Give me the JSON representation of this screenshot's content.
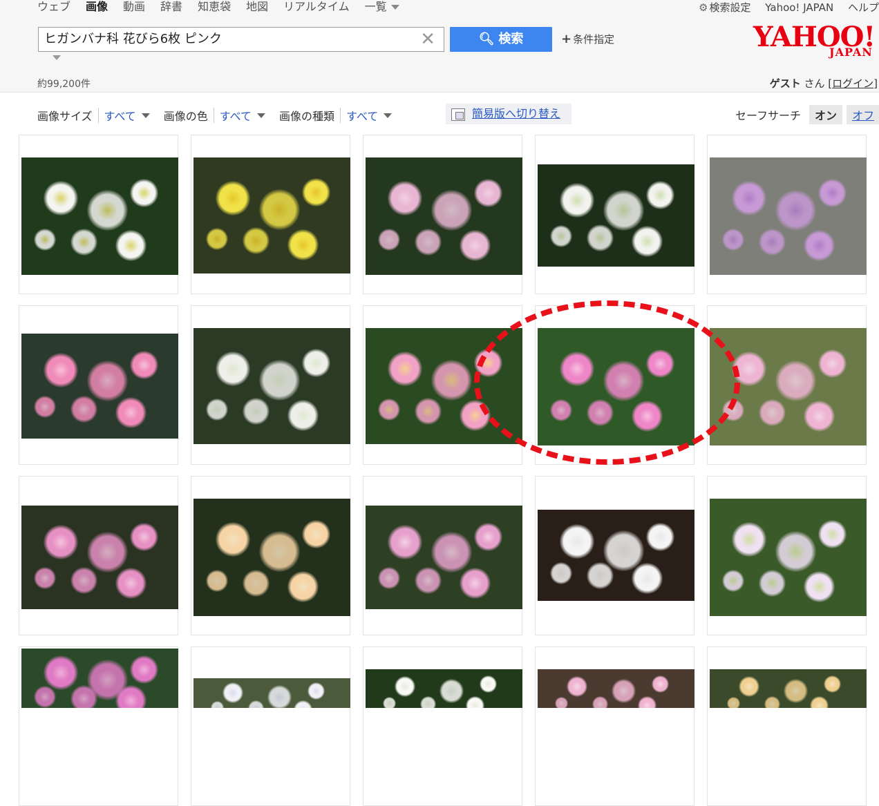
{
  "nav": {
    "items": [
      "ウェブ",
      "画像",
      "動画",
      "辞書",
      "知恵袋",
      "地図",
      "リアルタイム",
      "一覧"
    ],
    "active": "画像"
  },
  "toplinks": {
    "settings": "検索設定",
    "yahoo": "Yahoo! JAPAN",
    "help": "ヘルプ"
  },
  "search": {
    "query": "ヒガンバナ科 花びら6枚 ピンク",
    "button": "検索",
    "conditions": "条件指定"
  },
  "logo": {
    "main": "YAHOO!",
    "sub": "JAPAN"
  },
  "results": {
    "count": "約99,200件"
  },
  "user": {
    "name": "ゲスト",
    "suffix": " さん [",
    "login": "ログイン",
    "close": "]"
  },
  "filters": {
    "size_label": "画像サイズ",
    "size_value": "すべて",
    "color_label": "画像の色",
    "color_value": "すべて",
    "type_label": "画像の種類",
    "type_value": "すべて",
    "simple_mode": "簡易版へ切り替え"
  },
  "safesearch": {
    "label": "セーフサーチ",
    "on": "オン",
    "off": "オフ"
  },
  "icons": {
    "settings": "gear-icon",
    "search": "magnifier-icon",
    "clear": "close-icon",
    "plus": "plus-icon"
  },
  "colors": {
    "accent": "#3d86f0",
    "link": "#2b59c3",
    "brand": "#e60012",
    "annotation": "#e8111a"
  }
}
